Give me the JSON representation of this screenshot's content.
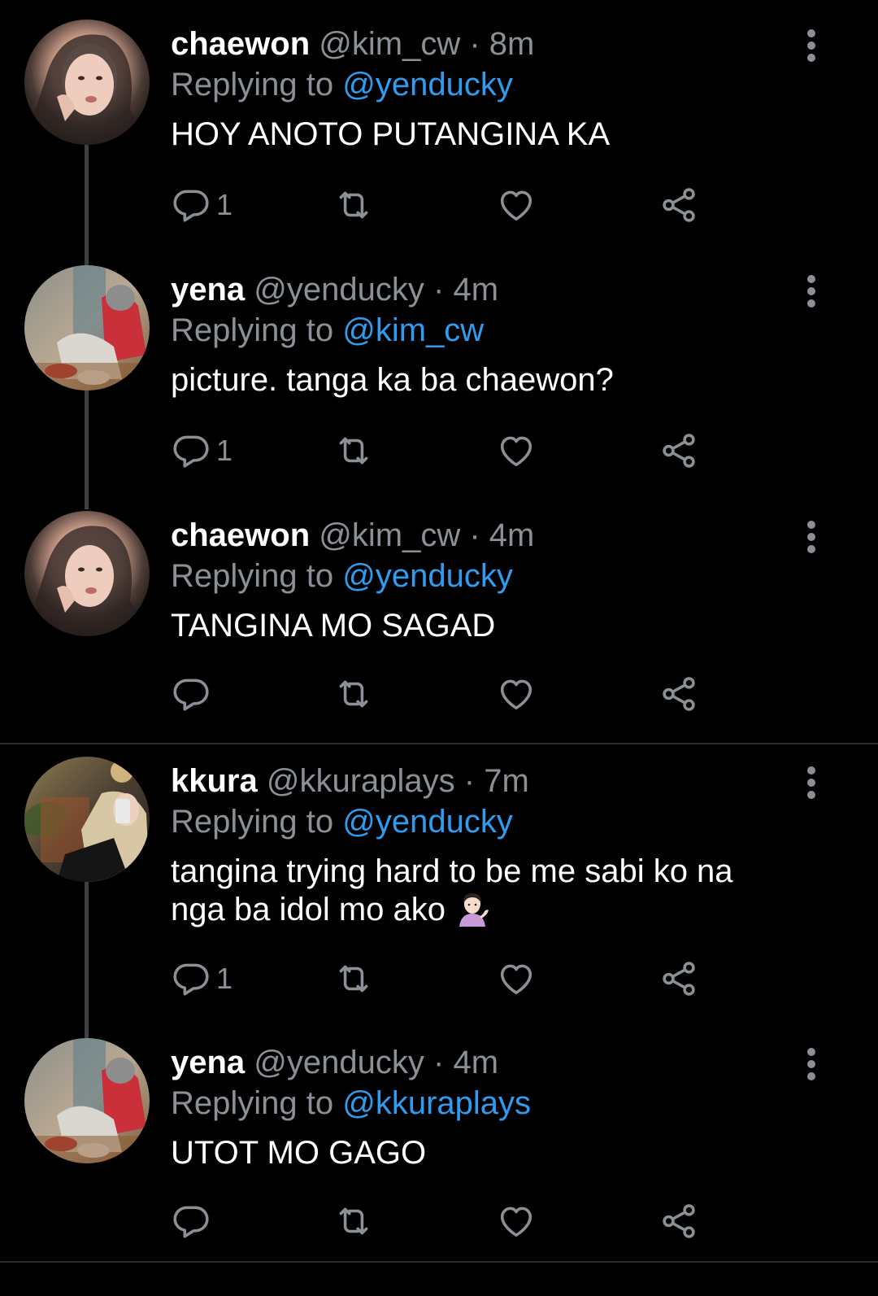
{
  "tweets": [
    {
      "name": "chaewon",
      "handle": "@kim_cw",
      "time": "· 8m",
      "replying_label": "Replying to",
      "replying_to": "@yenducky",
      "text": "HOY ANOTO PUTANGINA KA",
      "reply_count": "1",
      "avatar": "chaewon-avatar"
    },
    {
      "name": "yena",
      "handle": "@yenducky",
      "time": "· 4m",
      "replying_label": "Replying to",
      "replying_to": "@kim_cw",
      "text": "picture. tanga ka ba chaewon?",
      "reply_count": "1",
      "avatar": "yena-avatar"
    },
    {
      "name": "chaewon",
      "handle": "@kim_cw",
      "time": "· 4m",
      "replying_label": "Replying to",
      "replying_to": "@yenducky",
      "text": "TANGINA MO SAGAD",
      "reply_count": "",
      "avatar": "chaewon-avatar"
    },
    {
      "name": "kkura",
      "handle": "@kkuraplays",
      "time": "· 7m",
      "replying_label": "Replying to",
      "replying_to": "@yenducky",
      "text_line1": "tangina trying hard to be me sabi ko na",
      "text_line2": "nga ba idol mo ako",
      "emoji": "woman-tipping-hand-emoji",
      "reply_count": "1",
      "avatar": "kkura-avatar"
    },
    {
      "name": "yena",
      "handle": "@yenducky",
      "time": "· 4m",
      "replying_label": "Replying to",
      "replying_to": "@kkuraplays",
      "text": "UTOT MO GAGO",
      "reply_count": "",
      "avatar": "yena-avatar"
    }
  ],
  "icons": {
    "reply": "reply-icon",
    "retweet": "retweet-icon",
    "like": "heart-icon",
    "share": "share-icon",
    "more": "more-options-icon"
  },
  "colors": {
    "background": "#000000",
    "text": "#ffffff",
    "muted": "#8b9096",
    "mention": "#2f9cf0",
    "thread_line": "#3e4144"
  }
}
